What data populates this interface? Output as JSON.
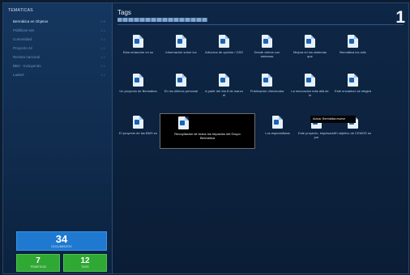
{
  "sidebar": {
    "title": "TEMATICAS",
    "items": [
      {
        "label": "Bermática en Objetos",
        "count": "0.5",
        "active": true
      },
      {
        "label": "Públlicas ses",
        "count": "1.1"
      },
      {
        "label": "Comunidad",
        "count": "1.1"
      },
      {
        "label": "Proyecto 42",
        "count": "1.1"
      },
      {
        "label": "Revista nacional",
        "count": "1.1"
      },
      {
        "label": "BBV - Incluyendo",
        "count": "1.1"
      },
      {
        "label": "Ladeel",
        "count": "1.1"
      }
    ],
    "stats": {
      "total": {
        "value": "34",
        "label": "DOCUMENTOS"
      },
      "left": {
        "value": "7",
        "label": "TEMATICAS"
      },
      "right": {
        "value": "12",
        "label": "TAGS"
      }
    }
  },
  "main": {
    "title": "Tags",
    "page_number": "1",
    "tiles": [
      {
        "caption": "Esta redacción en su",
        "icon": "document-icon"
      },
      {
        "caption": "Información sobre los",
        "icon": "document-icon"
      },
      {
        "caption": "Artículos de opinión / GSS",
        "icon": "document-icon"
      },
      {
        "caption": "Desde videos con sistemas",
        "icon": "document-icon"
      },
      {
        "caption": "Mejora en los sistemas que",
        "icon": "document-icon"
      },
      {
        "caption": "Bermática los sdls",
        "icon": "document-icon"
      },
      {
        "caption": "Un proyecto de Bermática",
        "icon": "document-icon"
      },
      {
        "caption": "En los últimos personal",
        "icon": "document-icon"
      },
      {
        "caption": "A partir del día 8 de marzo el",
        "icon": "document-icon"
      },
      {
        "caption": "Publicación ofrecimaba",
        "icon": "document-icon"
      },
      {
        "caption": "La innovación más allá de lo",
        "icon": "document-icon"
      },
      {
        "caption": "Este encabezo se elegirá",
        "icon": "document-icon"
      },
      {
        "caption": "El proyecto de las BMS es",
        "icon": "document-icon"
      },
      {
        "caption": "Recopilación de todos los impactos del Grupo Bermática",
        "icon": "document-icon",
        "selected": true
      },
      {
        "caption": "",
        "icon": "document-icon",
        "hidden": true
      },
      {
        "caption": "Los especialistas",
        "icon": "document-icon"
      },
      {
        "caption": "Este proyecto, impulsado por",
        "icon": "document-icon"
      },
      {
        "caption": "El objetivo de CEMOS es",
        "icon": "document-icon"
      }
    ],
    "tooltip": "Actuar. Bermática mueve"
  }
}
